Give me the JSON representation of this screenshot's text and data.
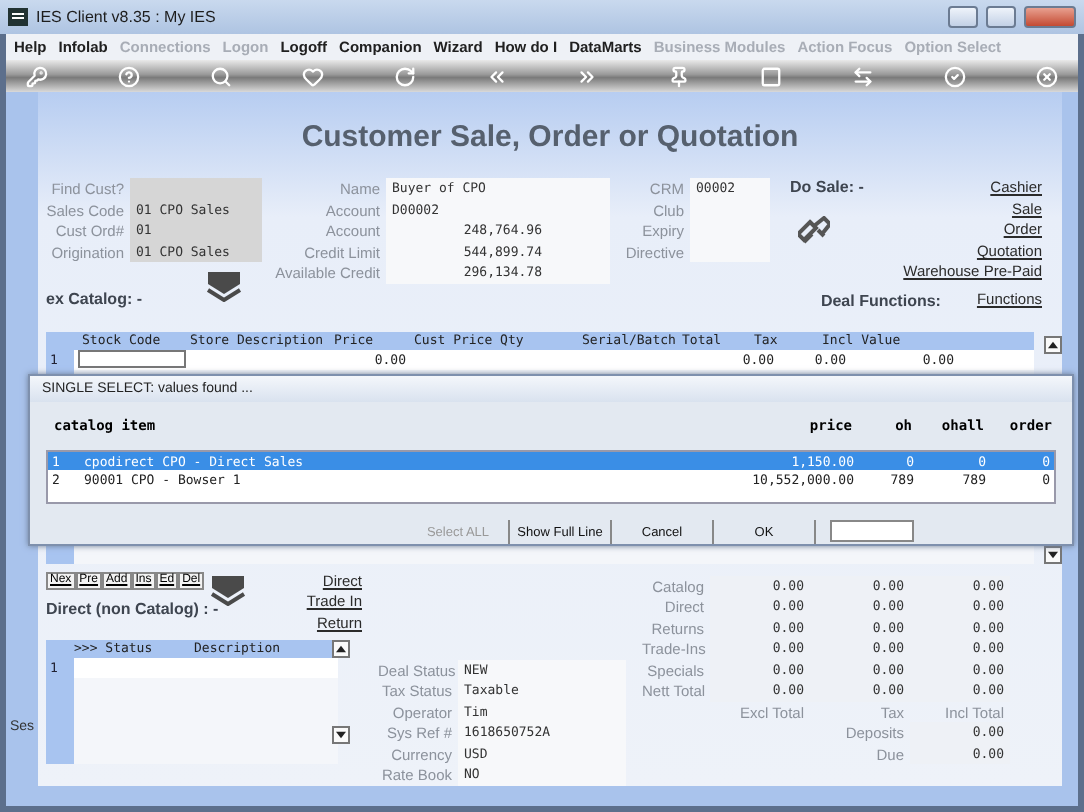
{
  "window": {
    "title": "IES Client v8.35 : My IES"
  },
  "menu": [
    {
      "label": "Help",
      "disabled": false
    },
    {
      "label": "Infolab",
      "disabled": false
    },
    {
      "label": "Connections",
      "disabled": true
    },
    {
      "label": "Logon",
      "disabled": true
    },
    {
      "label": "Logoff",
      "disabled": false
    },
    {
      "label": "Companion",
      "disabled": false
    },
    {
      "label": "Wizard",
      "disabled": false
    },
    {
      "label": "How do I",
      "disabled": false
    },
    {
      "label": "DataMarts",
      "disabled": false
    },
    {
      "label": "Business Modules",
      "disabled": true
    },
    {
      "label": "Action Focus",
      "disabled": true
    },
    {
      "label": "Option Select",
      "disabled": true
    }
  ],
  "heading": "Customer Sale, Order or Quotation",
  "customer_fields": [
    {
      "label": "Find Cust?"
    },
    {
      "label": "Sales Code",
      "value": "01 CPO Sales"
    },
    {
      "label": "Cust Ord#",
      "value": "01"
    },
    {
      "label": "Origination",
      "value": "01 CPO Sales"
    }
  ],
  "account_fields": [
    {
      "label": "Name",
      "value": "Buyer of CPO",
      "kind": "text"
    },
    {
      "label": "Account",
      "value": "D00002",
      "kind": "text"
    },
    {
      "label": "Account",
      "value": "248,764.96",
      "kind": "amount"
    },
    {
      "label": "Credit Limit",
      "value": "544,899.74",
      "kind": "amount"
    },
    {
      "label": "Available Credit",
      "value": "296,134.78",
      "kind": "amount"
    }
  ],
  "crm_fields": [
    {
      "label": "CRM",
      "value": "00002"
    },
    {
      "label": "Club"
    },
    {
      "label": "Expiry"
    },
    {
      "label": "Directive"
    }
  ],
  "do_sale": "Do Sale: -",
  "sale_links": [
    "Cashier",
    "Sale",
    "Order",
    "Quotation",
    "Warehouse Pre-Paid",
    "Functions"
  ],
  "deal_functions": "Deal Functions:",
  "catalog_label": "ex Catalog: -",
  "table": {
    "columns": [
      "Stock Code",
      "Store Description",
      "Price",
      "Cust Price Qty",
      "Serial/Batch",
      "Total",
      "Tax",
      "Incl Value"
    ],
    "rows": [
      {
        "number": "1",
        "price": "0.00",
        "total": "0.00",
        "tax": "0.00",
        "incl_value": "0.00"
      }
    ]
  },
  "dialog": {
    "title": "SINGLE SELECT: values found ...",
    "columns": [
      "catalog item",
      "price",
      "oh",
      "ohall",
      "order"
    ],
    "rows": [
      {
        "number": "1",
        "item": "cpodirect CPO - Direct Sales",
        "price": "1,150.00",
        "oh": "0",
        "ohall": "0",
        "order": "0",
        "selected": true
      },
      {
        "number": "2",
        "item": "90001 CPO - Bowser 1",
        "price": "10,552,000.00",
        "oh": "789",
        "ohall": "789",
        "order": "0",
        "selected": false
      }
    ],
    "buttons": [
      {
        "label": "Select ALL",
        "disabled": true
      },
      {
        "label": "Show Full Line",
        "disabled": false
      },
      {
        "label": "Cancel",
        "disabled": false
      },
      {
        "label": "OK",
        "disabled": false
      }
    ]
  },
  "nav_buttons": [
    "Nex",
    "Pre",
    "Add",
    "Ins",
    "Ed",
    "Del"
  ],
  "direct_label": "Direct (non Catalog) : -",
  "direct_links": [
    "Direct",
    "Trade In",
    "Return"
  ],
  "status_table": {
    "columns": [
      ">>> Status",
      "Description"
    ],
    "rows": [
      "1"
    ]
  },
  "side_stub": "Ses",
  "deal_fields": [
    {
      "label": "Deal Status",
      "value": "NEW"
    },
    {
      "label": "Tax Status",
      "value": "Taxable"
    },
    {
      "label": "Operator",
      "value": "Tim"
    },
    {
      "label": "Sys Ref #",
      "value": "1618650752A"
    },
    {
      "label": "Currency",
      "value": "USD"
    },
    {
      "label": "Rate Book",
      "value": "NO"
    }
  ],
  "totals": [
    {
      "label": "Catalog",
      "values": [
        "0.00",
        "0.00",
        "0.00"
      ]
    },
    {
      "label": "Direct",
      "values": [
        "0.00",
        "0.00",
        "0.00"
      ]
    },
    {
      "label": "Returns",
      "values": [
        "0.00",
        "0.00",
        "0.00"
      ]
    },
    {
      "label": "Trade-Ins",
      "values": [
        "0.00",
        "0.00",
        "0.00"
      ]
    },
    {
      "label": "Specials",
      "values": [
        "0.00",
        "0.00",
        "0.00"
      ]
    },
    {
      "label": "Nett Total",
      "values": [
        "0.00",
        "0.00",
        "0.00"
      ]
    }
  ],
  "total_headers": [
    "Excl Total",
    "Tax",
    "Incl Total"
  ],
  "deposits": {
    "label": "Deposits",
    "value": "0.00"
  },
  "due": {
    "label": "Due",
    "value": "0.00"
  }
}
